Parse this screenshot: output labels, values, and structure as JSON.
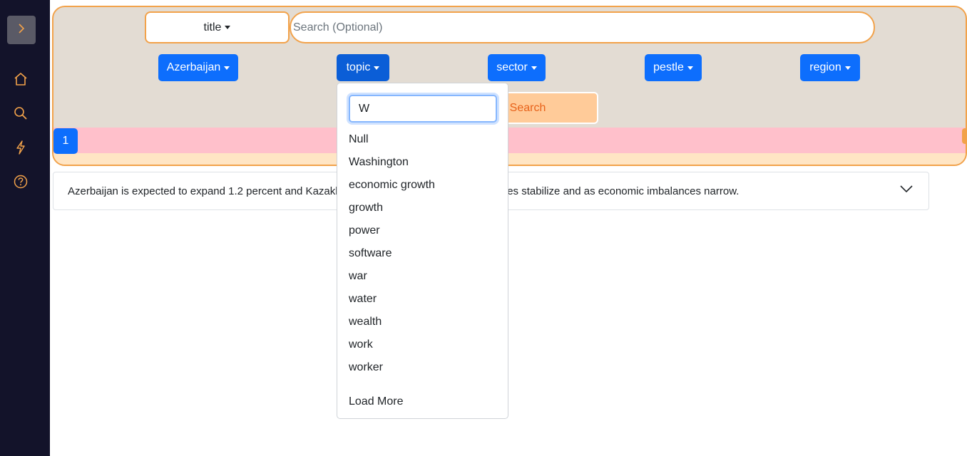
{
  "sidebar": {
    "icons": [
      "chevron-right-icon",
      "home-icon",
      "search-icon",
      "lightning-icon",
      "help-icon"
    ],
    "accent": "#f2a24a"
  },
  "search": {
    "field_select": "title",
    "placeholder": "Search (Optional)",
    "value": ""
  },
  "filters": {
    "country": "Azerbaijan",
    "topic": "topic",
    "sector": "sector",
    "pestle": "pestle",
    "region": "region"
  },
  "submit_label": "Search",
  "pagination": {
    "current": "1"
  },
  "result": {
    "text": "Azerbaijan is expected to expand 1.2 percent and Kazakhstan 2.2 percent as commodity prices stabilize and as economic imbalances narrow."
  },
  "topic_dropdown": {
    "search_value": "W",
    "items": [
      "Null",
      "Washington",
      "economic growth",
      "growth",
      "power",
      "software",
      "war",
      "water",
      "wealth",
      "work",
      "worker"
    ],
    "load_more": "Load More"
  },
  "colors": {
    "sidebar_bg": "#13132a",
    "panel_bg": "#e3dcd3",
    "primary": "#0d6efd",
    "accent": "#f2a24a",
    "pink": "#ffc0cb"
  }
}
